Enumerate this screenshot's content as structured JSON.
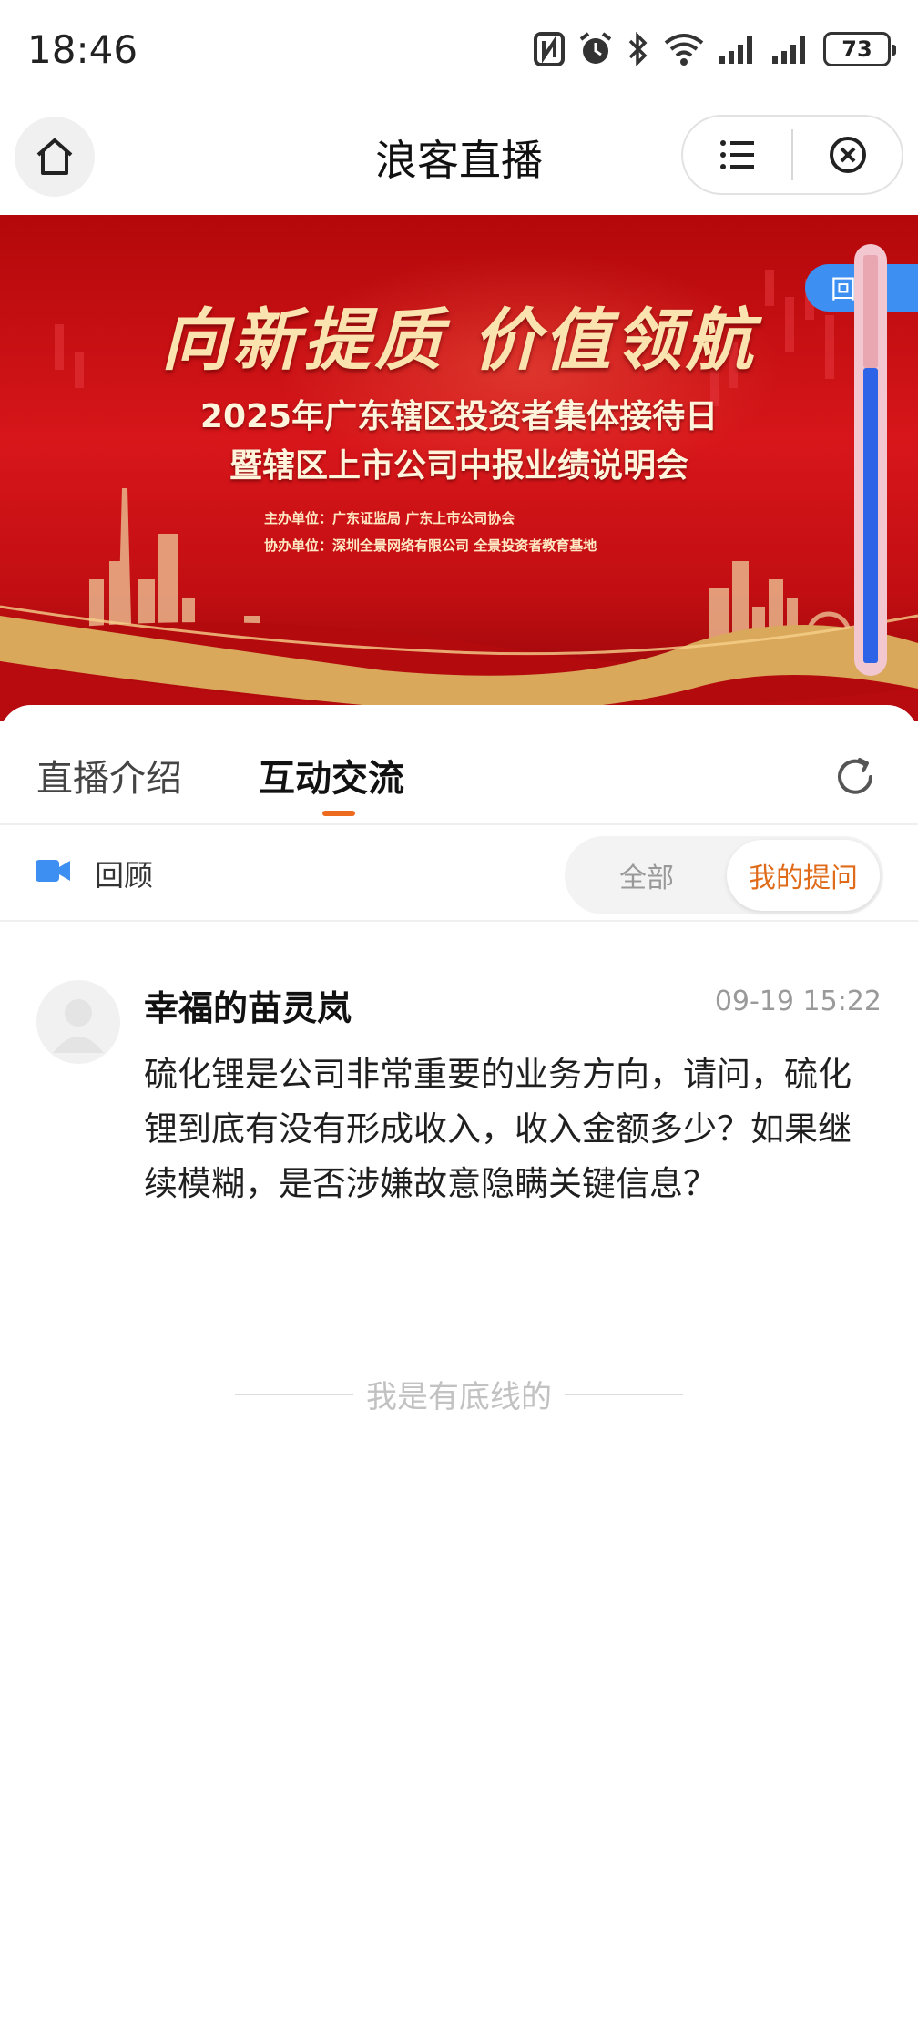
{
  "status_bar": {
    "time": "18:46",
    "battery": "73",
    "icons": [
      "nfc-icon",
      "alarm-icon",
      "bluetooth-icon",
      "wifi-icon",
      "signal-icon",
      "signal-icon-2",
      "battery-icon"
    ]
  },
  "header": {
    "title": "浪客直播",
    "icons": [
      "home-icon",
      "menu-icon",
      "close-icon"
    ]
  },
  "banner": {
    "headline": "向新提质 价值领航",
    "line1": "2025年广东辖区投资者集体接待日",
    "line2": "暨辖区上市公司中报业绩说明会",
    "organizer": "主办单位：广东证监局 广东上市公司协会",
    "co_organizer": "协办单位：深圳全景网络有限公司 全景投资者教育基地",
    "replay_tag": "回顾",
    "colors": {
      "background": "#c9111a",
      "gold": "#e8c27a",
      "replay_tag": "#3d8ff2",
      "scroll_fill": "#2d63e6"
    }
  },
  "tabs": {
    "items": [
      {
        "label": "直播介绍",
        "active": false
      },
      {
        "label": "互动交流",
        "active": true
      }
    ],
    "underline_color": "#ec6b1f",
    "refresh_icon": "refresh-icon"
  },
  "filter": {
    "replay_label": "回顾",
    "replay_icon": "video-camera-icon",
    "options": [
      {
        "label": "全部",
        "selected": false
      },
      {
        "label": "我的提问",
        "selected": true
      }
    ],
    "accent": "#e06b1a"
  },
  "question": {
    "user": "幸福的苗灵岚",
    "time": "09-19 15:22",
    "text": "硫化锂是公司非常重要的业务方向，请问，硫化锂到底有没有形成收入，收入金额多少？如果继续模糊，是否涉嫌故意隐瞒关键信息？"
  },
  "footer_note": "我是有底线的"
}
